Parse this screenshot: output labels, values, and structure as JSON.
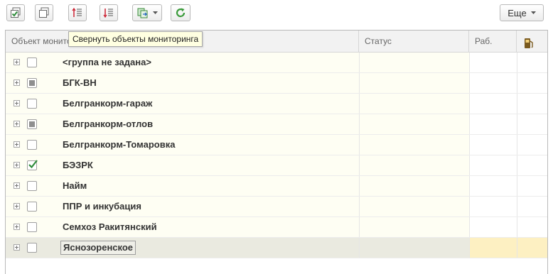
{
  "toolbar": {
    "check_all": "check-all-icon",
    "uncheck_all": "uncheck-all-icon",
    "collapse": "collapse-tree-icon",
    "expand": "expand-tree-icon",
    "group_menu": "group-action-icon",
    "refresh": "refresh-icon",
    "more_label": "Еще"
  },
  "tooltip": "Свернуть объекты мониторинга",
  "columns": {
    "object": "Объект мониторинга",
    "status": "Статус",
    "work": "Раб.",
    "fuel_icon": "fuel-pump-icon"
  },
  "rows": [
    {
      "name": "<группа не задана>",
      "check": "none"
    },
    {
      "name": "БГК-ВН",
      "check": "partial"
    },
    {
      "name": "Белгранкорм-гараж",
      "check": "none"
    },
    {
      "name": "Белгранкорм-отлов",
      "check": "partial"
    },
    {
      "name": "Белгранкорм-Томаровка",
      "check": "none"
    },
    {
      "name": "БЭЗРК",
      "check": "checked"
    },
    {
      "name": "Найм",
      "check": "none"
    },
    {
      "name": "ППР и инкубация",
      "check": "none"
    },
    {
      "name": "Семхоз Ракитянский",
      "check": "none"
    },
    {
      "name": "Яснозоренское",
      "check": "none",
      "selected": true
    }
  ],
  "colors": {
    "row_bg": "#fefef3",
    "selected_row": "#eaeae0",
    "selected_cell": "#fdf0c2",
    "check_green": "#2e8b3a",
    "refresh_green": "#3a9a3a"
  }
}
